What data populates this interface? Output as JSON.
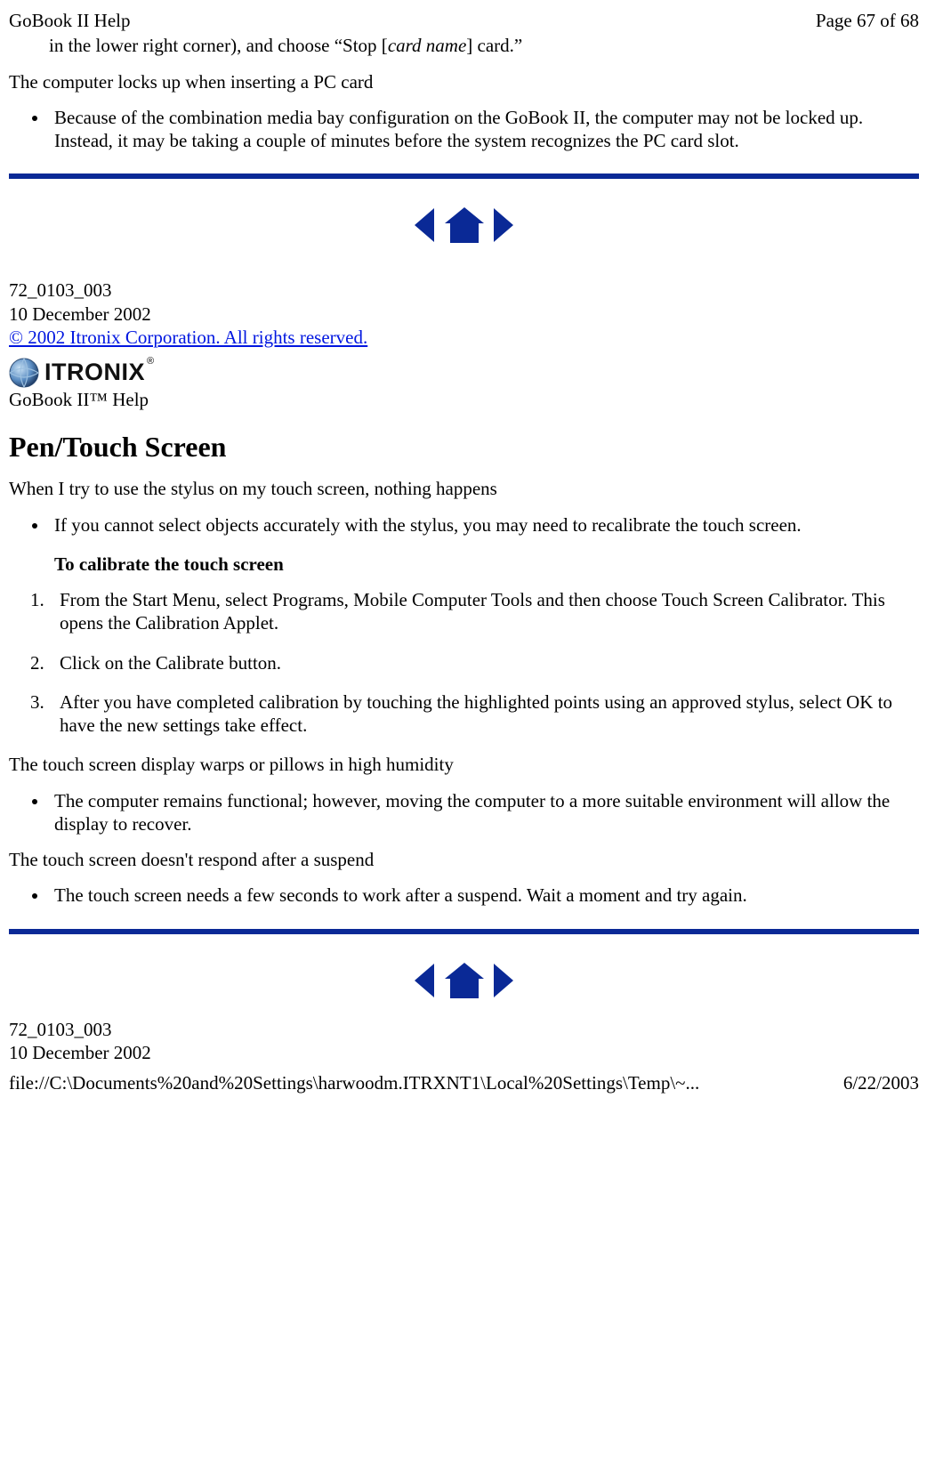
{
  "header": {
    "title_left": "GoBook II Help",
    "page_info": "Page 67 of 68"
  },
  "top_fragment": {
    "line1_prefix": "in the lower right corner), and choose “Stop [",
    "line1_italic": "card name",
    "line1_suffix": "] card.”"
  },
  "section_a": {
    "symptom1": "The computer locks up when inserting a PC card",
    "bullet1": "Because of the combination media bay configuration on the GoBook II, the computer may not be locked up.  Instead, it may be taking a couple of minutes before the system recognizes the PC card slot."
  },
  "doc_meta": {
    "number": "72_0103_003",
    "date": "10 December 2002",
    "copyright": "© 2002 Itronix Corporation.  All rights reserved."
  },
  "brand": {
    "name": "ITRONIX",
    "help_label": "GoBook II™ Help"
  },
  "section_b": {
    "title": "Pen/Touch Screen",
    "symptom1": "When I try to use the stylus on my touch screen, nothing happens",
    "bullet1": "If you cannot select objects accurately with the stylus, you may need to recalibrate the touch screen.",
    "cal_heading": "To calibrate the touch screen",
    "steps": [
      "From the Start Menu, select Programs, Mobile Computer Tools and then choose Touch Screen Calibrator.  This opens the Calibration Applet.",
      "Click on the Calibrate button.",
      "After you have completed calibration by touching the highlighted points using an approved stylus, select OK to have the new settings take effect."
    ],
    "symptom2": "The touch screen display warps or pillows in high humidity",
    "bullet2": "The computer remains functional; however, moving the computer to a more suitable environment will allow the display to recover.",
    "symptom3": "The touch screen doesn't respond after a suspend",
    "bullet3": "The touch screen needs a few seconds to work after a suspend.  Wait a moment and try again."
  },
  "footer": {
    "path": "file://C:\\Documents%20and%20Settings\\harwoodm.ITRXNT1\\Local%20Settings\\Temp\\~...",
    "date": "6/22/2003"
  }
}
